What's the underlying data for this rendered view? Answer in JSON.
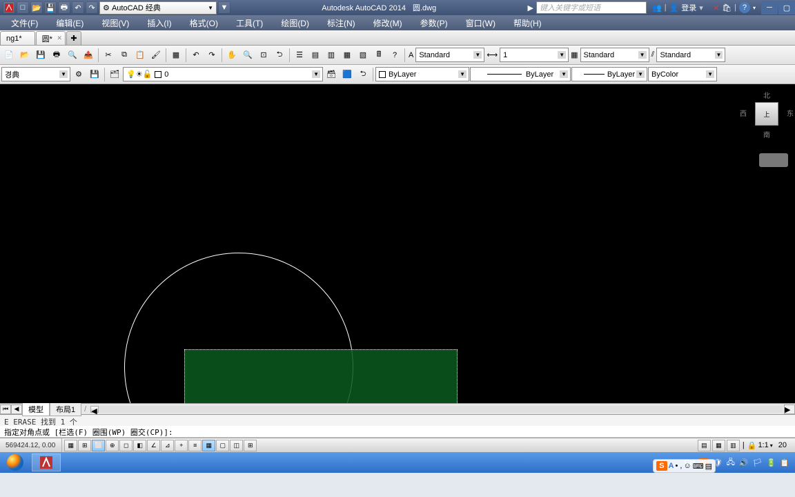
{
  "title": {
    "app": "Autodesk AutoCAD 2014",
    "file": "圆.dwg"
  },
  "qat": {
    "workspace": "AutoCAD 经典"
  },
  "search": {
    "placeholder": "键入关键字或短语"
  },
  "login": {
    "label": "登录"
  },
  "menu": [
    "文件(F)",
    "编辑(E)",
    "视图(V)",
    "插入(I)",
    "格式(O)",
    "工具(T)",
    "绘图(D)",
    "标注(N)",
    "修改(M)",
    "参数(P)",
    "窗口(W)",
    "帮助(H)"
  ],
  "tabs": {
    "t1": "ng1*",
    "t2": "圆*"
  },
  "styles": {
    "textstyle": "Standard",
    "dimstyle": "1",
    "tablestyle": "Standard",
    "mlstyle": "Standard"
  },
  "workspace2": {
    "label": "경典"
  },
  "layer": {
    "current": "0"
  },
  "props": {
    "color": "ByLayer",
    "linetype": "ByLayer",
    "lineweight": "ByLayer",
    "plotstyle": "ByColor"
  },
  "viewcube": {
    "top": "北",
    "left": "西",
    "right": "东",
    "bottom": "南",
    "face": "上"
  },
  "layouts": {
    "model": "模型",
    "layout1": "布局1"
  },
  "cmd": {
    "history": "E ERASE 找到 1 个",
    "prompt": "指定对角点或 [栏选(F) 圈围(WP) 圈交(CP)]:"
  },
  "status": {
    "coords": "569424.12, 0.00",
    "scale": "1:1",
    "right_num": "20"
  },
  "ime": {
    "lang": "CH",
    "letter": "S"
  },
  "sogou": {
    "s": "S",
    "a": "A",
    "dot": "• ,"
  }
}
